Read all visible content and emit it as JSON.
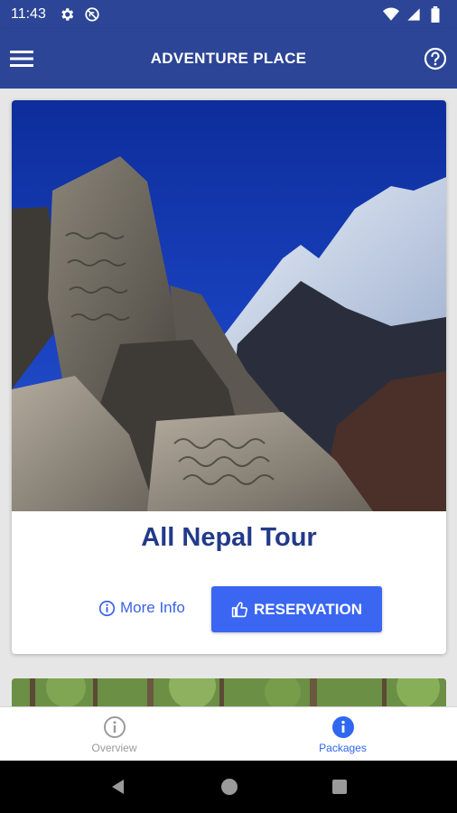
{
  "status_bar": {
    "time": "11:43",
    "icons": [
      "gear-icon",
      "no-disturb-icon",
      "wifi-icon",
      "signal-icon",
      "battery-icon"
    ]
  },
  "app_bar": {
    "title": "ADVENTURE PLACE",
    "menu_icon": "hamburger-menu-icon",
    "help_icon": "help-circle-icon"
  },
  "cards": [
    {
      "title": "All Nepal Tour",
      "more_info_label": "More Info",
      "reservation_label": "RESERVATION"
    }
  ],
  "bottom_nav": {
    "items": [
      {
        "label": "Overview",
        "icon": "info-outline-icon",
        "active": false
      },
      {
        "label": "Packages",
        "icon": "info-filled-icon",
        "active": true
      }
    ]
  },
  "colors": {
    "primary": "#2c4596",
    "accent": "#3a66f2",
    "title_text": "#233a8a",
    "active_nav": "#2f67f0"
  }
}
